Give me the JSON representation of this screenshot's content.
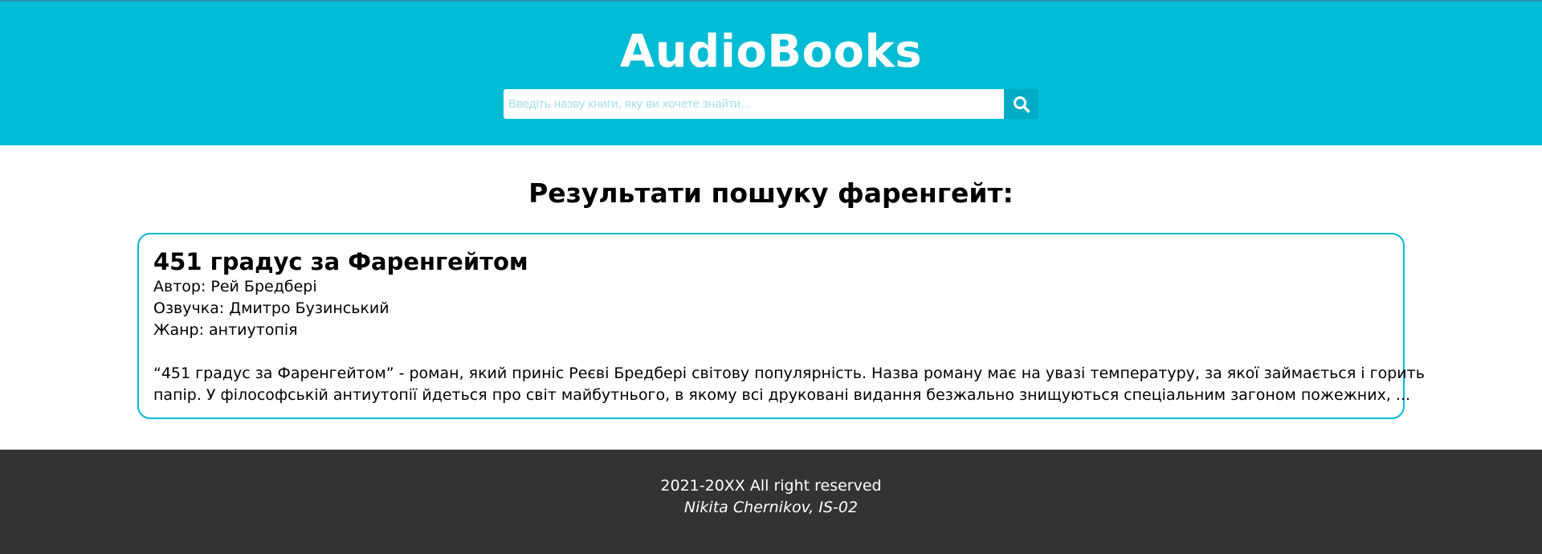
{
  "header": {
    "brand": "AudioBooks",
    "search_placeholder": "Введіть назву книги, яку ви хочете знайти...",
    "search_value": "",
    "search_icon": "search-icon",
    "background_color": "#00bcd4"
  },
  "main": {
    "results_title": "Результати пошуку фаренгейт:",
    "results": [
      {
        "title": "451 градус за Фаренгейтом",
        "author": "Автор: Рей Бредбері",
        "narrator": "Озвучка: Дмитро Бузинський",
        "genre": "Жанр: антиутопія",
        "description_line1": "“451 градус за Фаренгейтом” - роман, який приніс Реєві Бредбері світову популярність. Назва роману має на увазі температуру, за якої займається і горить",
        "description_line2": "папір. У філософській антиутопії йдеться про світ майбутнього, в якому всі друковані видання безжально знищуються спеціальним загоном пожежних, ..."
      }
    ]
  },
  "footer": {
    "copyright": "2021-20XX All right reserved",
    "author": "Nikita Chernikov, IS-02",
    "background_color": "#333333"
  }
}
